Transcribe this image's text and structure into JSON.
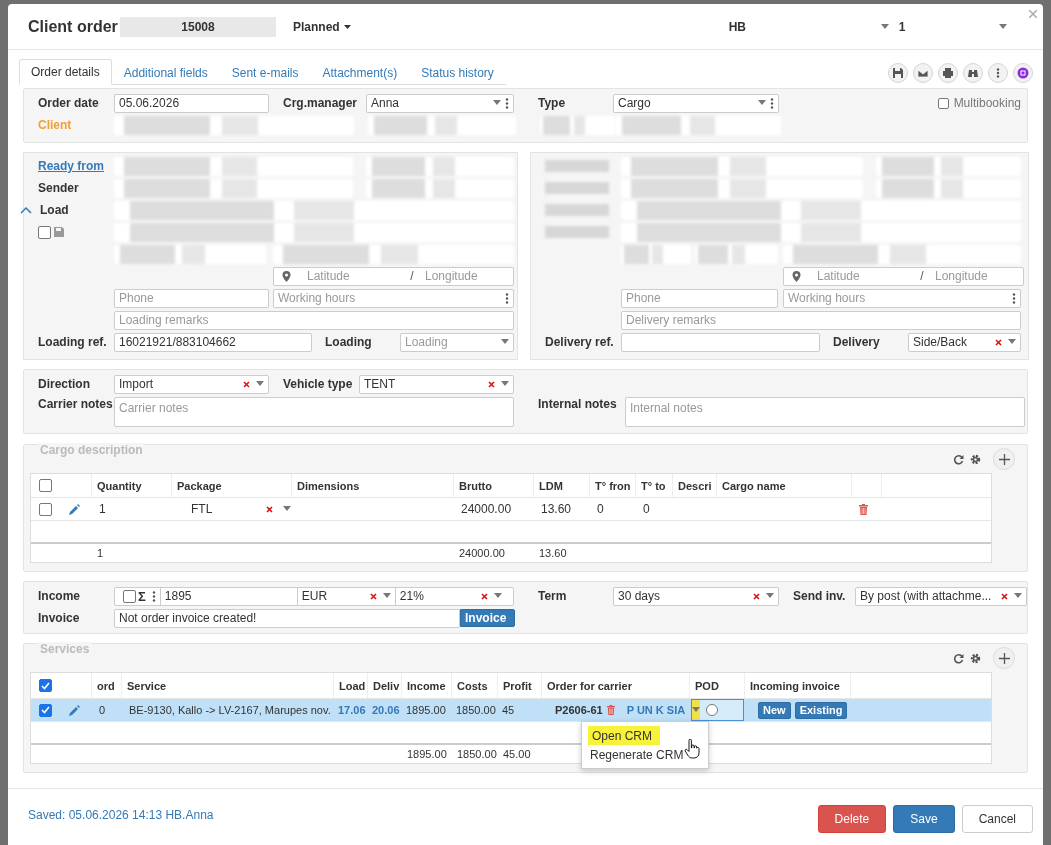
{
  "header": {
    "title": "Client order",
    "number": "15008",
    "status": "Planned",
    "company": "HB",
    "user": "1"
  },
  "tabs": [
    {
      "label": "Order details",
      "selected": true
    },
    {
      "label": "Additional fields",
      "selected": false
    },
    {
      "label": "Sent e-mails",
      "selected": false
    },
    {
      "label": "Attachment(s)",
      "selected": false
    },
    {
      "label": "Status history",
      "selected": false
    }
  ],
  "order": {
    "date_label": "Order date",
    "date": "05.06.2026",
    "manager_label": "Crg.manager",
    "manager": "Anna",
    "type_label": "Type",
    "type": "Cargo",
    "multibooking": {
      "label": "Multibooking",
      "checked": false
    },
    "client_label": "Client"
  },
  "loading": {
    "ready_label": "Ready from",
    "sender_label": "Sender",
    "load_label": "Load",
    "expanded": true,
    "save_checked": false,
    "latitude_placeholder": "Latitude",
    "separator": "/",
    "longitude_placeholder": "Longitude",
    "phone_placeholder": "Phone",
    "hours_placeholder": "Working hours",
    "remarks_placeholder": "Loading remarks",
    "ref_label": "Loading ref.",
    "ref": "16021921/883104662",
    "mode_label": "Loading",
    "mode_placeholder": "Loading"
  },
  "delivery": {
    "latitude_placeholder": "Latitude",
    "separator": "/",
    "longitude_placeholder": "Longitude",
    "phone_placeholder": "Phone",
    "hours_placeholder": "Working hours",
    "remarks_placeholder": "Delivery remarks",
    "ref_label": "Delivery ref.",
    "mode_label": "Delivery",
    "mode": "Side/Back"
  },
  "transport": {
    "direction_label": "Direction",
    "direction": "Import",
    "vehicle_label": "Vehicle type",
    "vehicle": "TENT",
    "carrier_notes_label": "Carrier notes",
    "carrier_notes_placeholder": "Carrier notes",
    "internal_notes_label": "Internal notes",
    "internal_notes_placeholder": "Internal notes"
  },
  "cargo": {
    "title": "Cargo description",
    "all_checked": false,
    "columns": [
      "Quantity",
      "Package",
      "Dimensions",
      "Brutto",
      "LDM",
      "T° fron",
      "T° to",
      "Descri",
      "Cargo name"
    ],
    "rows": [
      {
        "checked": false,
        "quantity": "1",
        "package": "FTL",
        "brutto": "24000.00",
        "ldm": "13.60",
        "t_from": "0",
        "t_to": "0"
      }
    ],
    "totals": {
      "quantity": "1",
      "brutto": "24000.00",
      "ldm": "13.60"
    }
  },
  "finance": {
    "income_label": "Income",
    "vat_included": false,
    "sum_sign": "Σ",
    "income": "1895",
    "currency": "EUR",
    "vat": "21%",
    "term_label": "Term",
    "term": "30 days",
    "send_label": "Send inv.",
    "send": "By post (with attachme...",
    "invoice_label": "Invoice",
    "invoice_status": "Not order invoice created!",
    "invoice_button": "Invoice"
  },
  "services": {
    "title": "Services",
    "all_checked": true,
    "columns": [
      "ord",
      "Service",
      "Load",
      "Deliv",
      "Income",
      "Costs",
      "Profit",
      "Order for carrier",
      "POD",
      "Incoming invoice"
    ],
    "rows": [
      {
        "selected": true,
        "checked": true,
        "ord": "0",
        "service": "BE-9130, Kallo -> LV-2167, Marupes nov.",
        "load": "17.06",
        "delivery": "20.06",
        "income": "1895.00",
        "costs": "1850.00",
        "profit": "45",
        "order_number": "P2606-61",
        "carrier": "P UN K SIA",
        "pod_checked": false,
        "invoice_buttons": [
          "New",
          "Existing"
        ]
      }
    ],
    "totals": {
      "income": "1895.00",
      "costs": "1850.00",
      "profit": "45.00"
    }
  },
  "context_menu": {
    "items": [
      {
        "label": "Open CRM",
        "selected": true
      },
      {
        "label": "Regenerate CRM",
        "selected": false
      }
    ]
  },
  "footer": {
    "saved": "Saved: 05.06.2026 14:13 HB.Anna",
    "buttons": [
      {
        "label": "Delete",
        "kind": "danger"
      },
      {
        "label": "Save",
        "kind": "primary"
      },
      {
        "label": "Cancel",
        "kind": "default"
      }
    ]
  }
}
